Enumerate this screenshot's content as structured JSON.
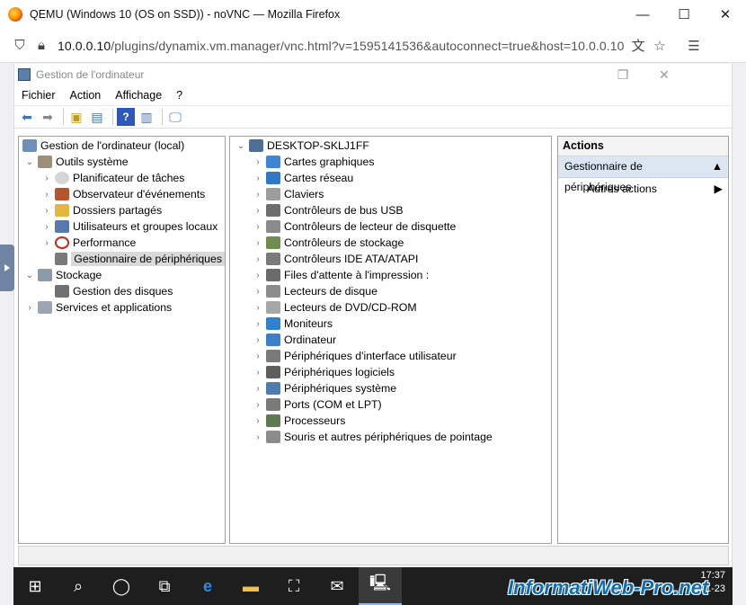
{
  "firefox": {
    "title": "QEMU (Windows 10 (OS on SSD)) - noVNC — Mozilla Firefox",
    "url_host": "10.0.0.10",
    "url_path": "/plugins/dynamix.vm.manager/vnc.html?v=1595141536&autoconnect=true&host=10.0.0.10",
    "min": "—",
    "max": "☐",
    "close": "✕"
  },
  "mmc": {
    "title": "Gestion de l'ordinateur",
    "menu": [
      "Fichier",
      "Action",
      "Affichage",
      "?"
    ]
  },
  "tree": {
    "root": "Gestion de l'ordinateur (local)",
    "system_tools": "Outils système",
    "items": [
      "Planificateur de tâches",
      "Observateur d'événements",
      "Dossiers partagés",
      "Utilisateurs et groupes locaux",
      "Performance",
      "Gestionnaire de périphériques"
    ],
    "storage": "Stockage",
    "disk_mgmt": "Gestion des disques",
    "services": "Services et applications"
  },
  "devices": {
    "computer": "DESKTOP-SKLJ1FF",
    "list": [
      "Cartes graphiques",
      "Cartes réseau",
      "Claviers",
      "Contrôleurs de bus USB",
      "Contrôleurs de lecteur de disquette",
      "Contrôleurs de stockage",
      "Contrôleurs IDE ATA/ATAPI",
      "Files d'attente à l'impression :",
      "Lecteurs de disque",
      "Lecteurs de DVD/CD-ROM",
      "Moniteurs",
      "Ordinateur",
      "Périphériques d'interface utilisateur",
      "Périphériques logiciels",
      "Périphériques système",
      "Ports (COM et LPT)",
      "Processeurs",
      "Souris et autres périphériques de pointage"
    ]
  },
  "actions": {
    "header": "Actions",
    "section": "Gestionnaire de périphériques",
    "more": "Autres actions"
  },
  "taskbar": {
    "time": "17:37",
    "date": "23-11-23"
  },
  "watermark": "InformatiWeb-Pro.net"
}
